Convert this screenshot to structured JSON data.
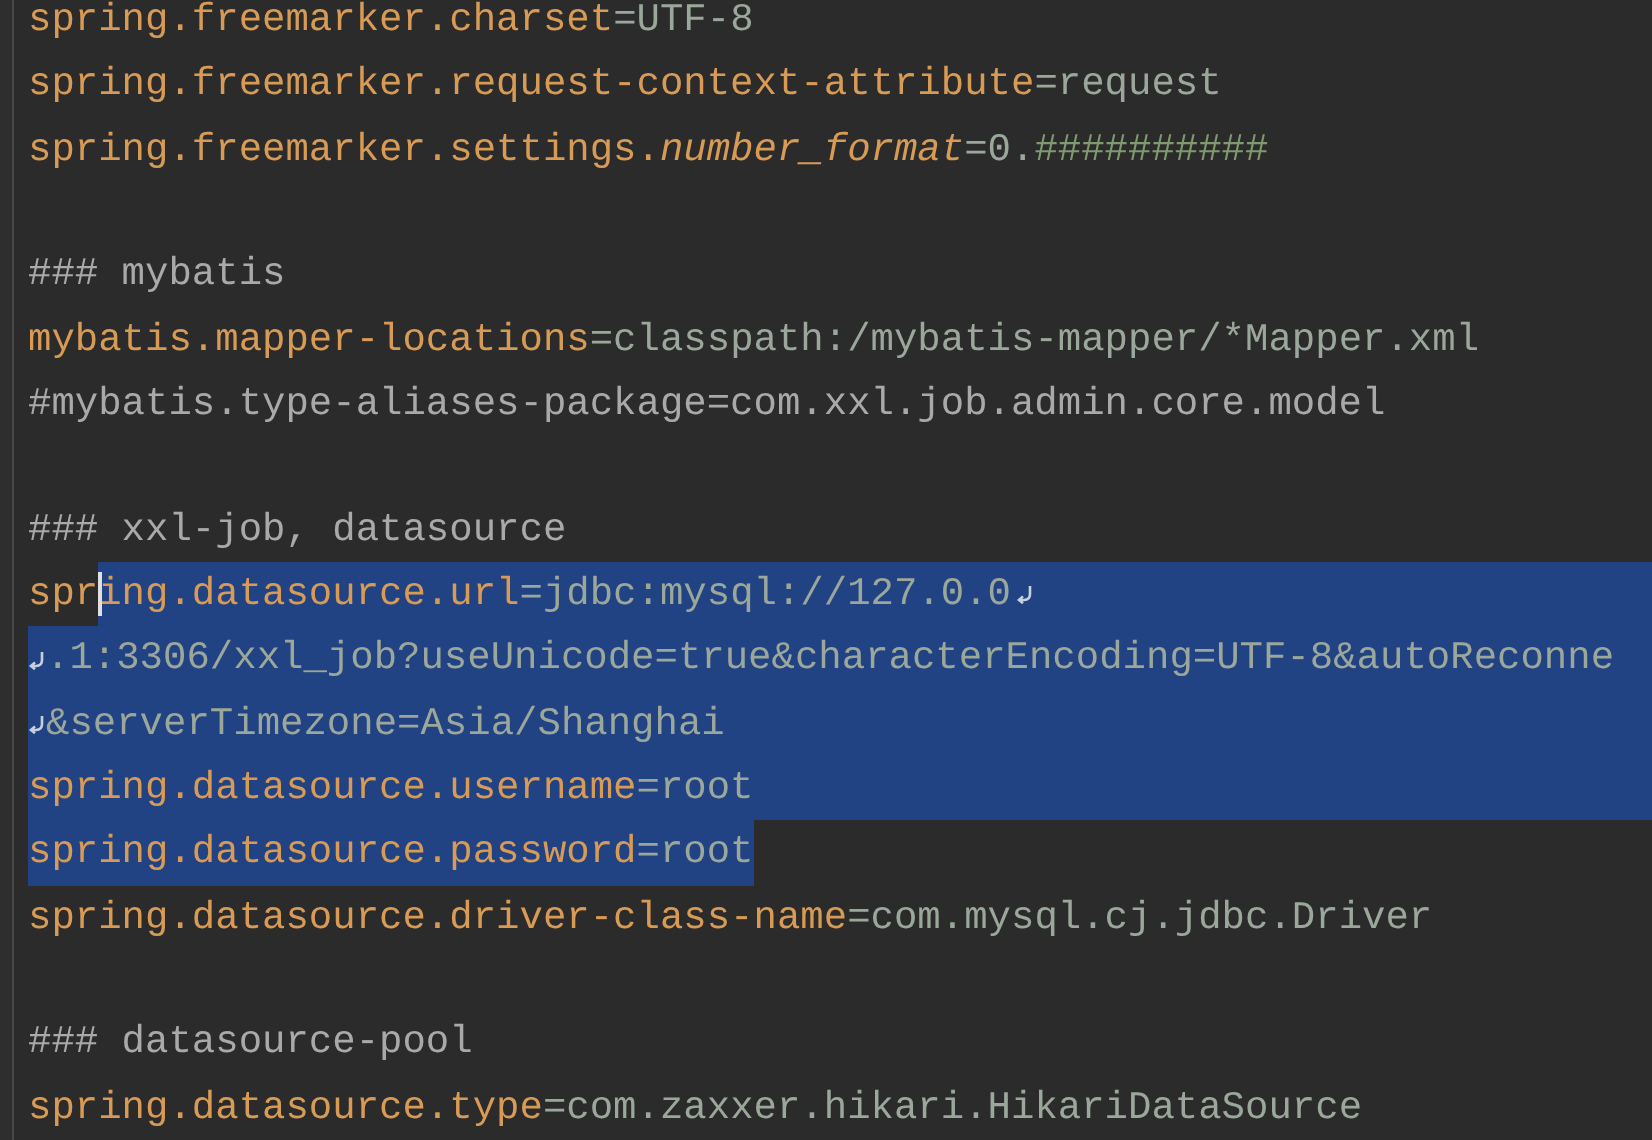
{
  "editor": {
    "lines": [
      {
        "kind": "code",
        "selected": false,
        "wrap_start": false,
        "wrap_end": false,
        "segments": [
          {
            "kind": "key",
            "text": "spring.freemarker.charset"
          },
          {
            "kind": "value",
            "text": "=UTF-8"
          }
        ]
      },
      {
        "kind": "code",
        "selected": false,
        "wrap_start": false,
        "wrap_end": false,
        "segments": [
          {
            "kind": "key",
            "text": "spring.freemarker.request-context-attribute"
          },
          {
            "kind": "value",
            "text": "=request"
          }
        ]
      },
      {
        "kind": "code",
        "selected": false,
        "wrap_start": false,
        "wrap_end": false,
        "segments": [
          {
            "kind": "key",
            "text": "spring.freemarker.settings."
          },
          {
            "kind": "key-italic",
            "text": "number_format"
          },
          {
            "kind": "value",
            "text": "=0."
          },
          {
            "kind": "value-accent",
            "text": "##########"
          }
        ]
      },
      {
        "kind": "blank"
      },
      {
        "kind": "code",
        "selected": false,
        "wrap_start": false,
        "wrap_end": false,
        "segments": [
          {
            "kind": "comment",
            "text": "### mybatis"
          }
        ]
      },
      {
        "kind": "code",
        "selected": false,
        "wrap_start": false,
        "wrap_end": false,
        "segments": [
          {
            "kind": "key",
            "text": "mybatis.mapper-locations"
          },
          {
            "kind": "value",
            "text": "=classpath:/mybatis-mapper/*Mapper.xml"
          }
        ]
      },
      {
        "kind": "code",
        "selected": false,
        "wrap_start": false,
        "wrap_end": false,
        "segments": [
          {
            "kind": "comment",
            "text": "#mybatis.type-aliases-package=com.xxl.job.admin.core.model"
          }
        ]
      },
      {
        "kind": "blank"
      },
      {
        "kind": "code",
        "selected": false,
        "wrap_start": false,
        "wrap_end": false,
        "segments": [
          {
            "kind": "comment",
            "text": "### xxl-job, datasource"
          }
        ]
      },
      {
        "kind": "code",
        "selected": true,
        "selected_to_edge": true,
        "wrap_start": false,
        "wrap_end": true,
        "segments": [
          {
            "kind": "key",
            "text": "spr",
            "selected": false
          },
          {
            "kind": "key",
            "text": "ing.datasource.url",
            "selected": true,
            "caret_before": true
          },
          {
            "kind": "value",
            "text": "=jdbc:mysql://127.0.0",
            "selected": true
          }
        ]
      },
      {
        "kind": "code",
        "selected": true,
        "selected_to_edge": true,
        "wrap_start": true,
        "wrap_end": false,
        "segments": [
          {
            "kind": "value",
            "text": ".1:3306/xxl_job?useUnicode=true&characterEncoding=UTF-8&autoReconne"
          }
        ]
      },
      {
        "kind": "code",
        "selected": true,
        "selected_to_edge": true,
        "wrap_start": true,
        "wrap_end": false,
        "segments": [
          {
            "kind": "value",
            "text": "&serverTimezone=Asia/Shanghai"
          }
        ]
      },
      {
        "kind": "code",
        "selected": true,
        "selected_to_edge": true,
        "wrap_start": false,
        "wrap_end": false,
        "segments": [
          {
            "kind": "key",
            "text": "spring.datasource.username"
          },
          {
            "kind": "value",
            "text": "=root"
          }
        ]
      },
      {
        "kind": "code",
        "selected": true,
        "selected_to_edge": false,
        "wrap_start": false,
        "wrap_end": false,
        "segments": [
          {
            "kind": "key",
            "text": "spring.datasource.password"
          },
          {
            "kind": "value",
            "text": "=root"
          }
        ]
      },
      {
        "kind": "code",
        "selected": false,
        "wrap_start": false,
        "wrap_end": false,
        "segments": [
          {
            "kind": "key",
            "text": "spring.datasource.driver-class-name"
          },
          {
            "kind": "value",
            "text": "=com.mysql.cj.jdbc.Driver"
          }
        ]
      },
      {
        "kind": "blank"
      },
      {
        "kind": "code",
        "selected": false,
        "wrap_start": false,
        "wrap_end": false,
        "segments": [
          {
            "kind": "comment",
            "text": "### datasource-pool"
          }
        ]
      },
      {
        "kind": "code",
        "selected": false,
        "wrap_start": false,
        "wrap_end": false,
        "segments": [
          {
            "kind": "key",
            "text": "spring.datasource.type"
          },
          {
            "kind": "value",
            "text": "=com.zaxxer.hikari.HikariDataSource"
          }
        ]
      }
    ]
  }
}
